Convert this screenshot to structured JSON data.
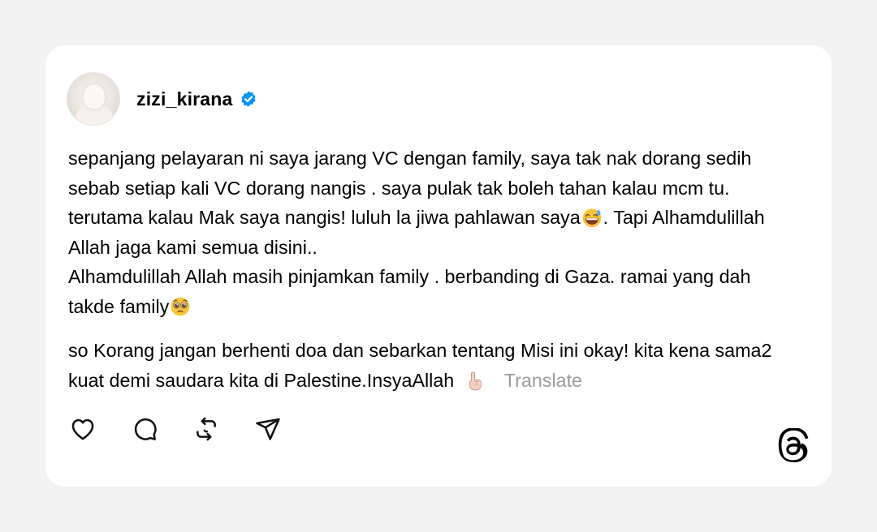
{
  "post": {
    "username": "zizi_kirana",
    "verified": true,
    "paragraph1": [
      "sepanjang pelayaran ni saya jarang VC dengan family, saya tak nak dorang sedih sebab setiap kali VC dorang nangis . saya pulak tak boleh tahan kalau mcm tu. terutama kalau Mak saya nangis! luluh la jiwa pahlawan saya",
      ". Tapi Alhamdulillah Allah jaga kami semua disini.."
    ],
    "paragraph1_line2": "Alhamdulillah Allah masih pinjamkan family . berbanding di Gaza. ramai yang dah takde family",
    "paragraph2": "so Korang jangan berhenti doa dan sebarkan tentang Misi ini okay! kita kena sama2 kuat demi saudara kita di Palestine.InsyaAllah",
    "translate_label": "Translate",
    "emojis": [
      "grinning-face-with-sweat",
      "pleading-face",
      "index-pointing-up"
    ]
  },
  "actions": [
    {
      "name": "like",
      "icon": "heart-icon"
    },
    {
      "name": "reply",
      "icon": "comment-icon"
    },
    {
      "name": "repost",
      "icon": "repost-icon"
    },
    {
      "name": "share",
      "icon": "send-icon"
    }
  ],
  "brand": {
    "logo": "threads-logo-icon"
  },
  "colors": {
    "background": "#f2f2f2",
    "card": "#ffffff",
    "verified_blue": "#0095f6",
    "translate_gray": "#9a9a9a"
  }
}
